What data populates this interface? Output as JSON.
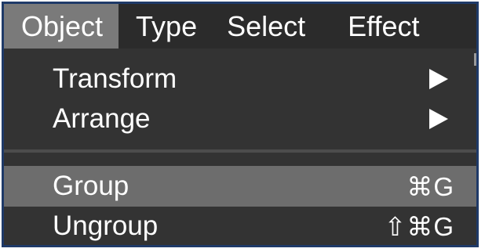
{
  "menubar": {
    "items": [
      {
        "label": "Object",
        "active": true
      },
      {
        "label": "Type",
        "active": false
      },
      {
        "label": "Select",
        "active": false
      },
      {
        "label": "Effect",
        "active": false
      }
    ]
  },
  "dropdown": {
    "items": [
      {
        "label": "Transform",
        "submenu": true,
        "icon": "submenu-arrow-icon"
      },
      {
        "label": "Arrange",
        "submenu": true,
        "icon": "submenu-arrow-icon"
      },
      {
        "label": "Group",
        "shortcut": "⌘G",
        "highlighted": true
      },
      {
        "label": "Ungroup",
        "shortcut": "⇧⌘G",
        "highlighted": false
      }
    ]
  },
  "colors": {
    "menu_background": "#333333",
    "highlight": "#6d6d6d",
    "active_menubar": "#7a7a7a",
    "frame_border": "#1f3a68",
    "text": "#ffffff"
  }
}
